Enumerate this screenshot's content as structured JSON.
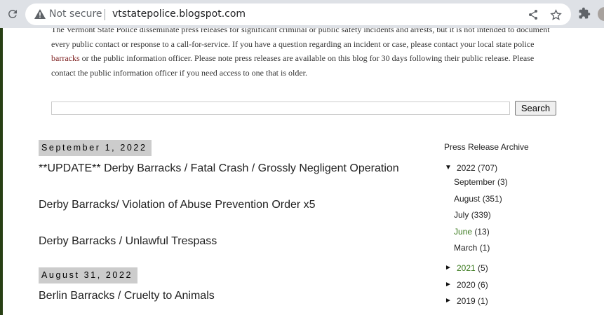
{
  "browser": {
    "security_label": "Not secure",
    "url": "vtstatepolice.blogspot.com"
  },
  "intro": {
    "text_before_link": "The Vermont State Police disseminate press releases for significant criminal or public safety incidents and arrests, but it is not intended to document every public contact or response to a call-for-service. If you have a question regarding an incident or case, please contact your local state police ",
    "link": "barracks",
    "text_after_link": " or the public information officer. Please note press releases are available on this blog for 30 days following their public release. Please contact the public information officer if you need access to one that is older."
  },
  "search": {
    "value": "",
    "button_label": "Search"
  },
  "posts": {
    "date1": "September 1, 2022",
    "title1": "**UPDATE** Derby Barracks / Fatal Crash / Grossly Negligent Operation",
    "title2": "Derby Barracks/ Violation of Abuse Prevention Order x5",
    "title3": "Derby Barracks / Unlawful Trespass",
    "date2": "August 31, 2022",
    "title4": "Berlin Barracks / Cruelty to Animals"
  },
  "archive": {
    "title": "Press Release Archive",
    "y2022": {
      "toggle": "▼",
      "label": "2022",
      "count": "(707)"
    },
    "months": {
      "september": {
        "label": "September",
        "count": "(3)"
      },
      "august": {
        "label": "August",
        "count": "(351)"
      },
      "july": {
        "label": "July",
        "count": "(339)"
      },
      "june": {
        "label": "June",
        "count": "(13)"
      },
      "march": {
        "label": "March",
        "count": "(1)"
      }
    },
    "y2021": {
      "toggle": "►",
      "label": "2021",
      "count": "(5)"
    },
    "y2020": {
      "toggle": "►",
      "label": "2020",
      "count": "(6)"
    },
    "y2019": {
      "toggle": "►",
      "label": "2019",
      "count": "(1)"
    }
  },
  "colors": {
    "link_maroon": "#7b1c1c",
    "link_green": "#3b7a1e",
    "left_bar": "#273f13",
    "date_header_bg": "#cccccc"
  }
}
